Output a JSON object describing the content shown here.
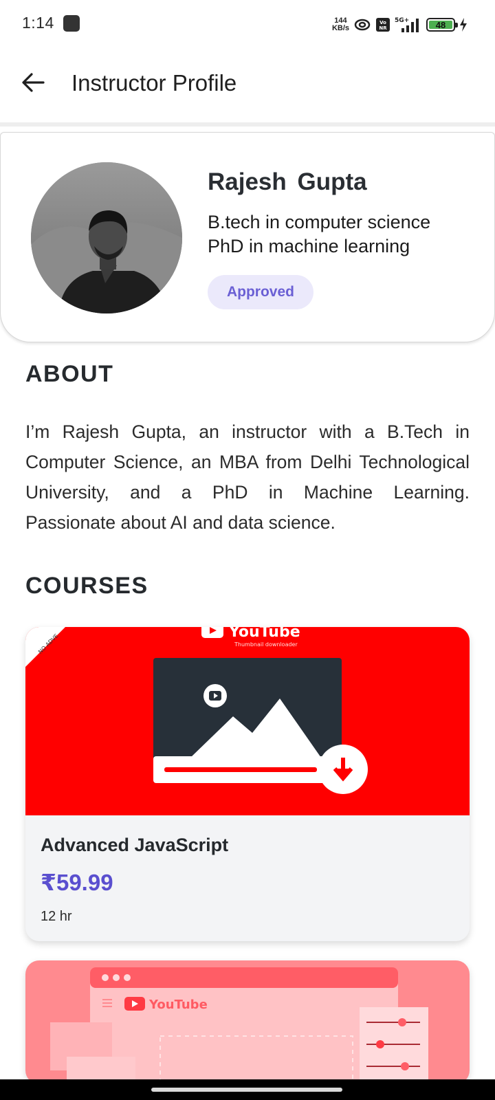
{
  "status_bar": {
    "time": "1:14",
    "net_speed_value": "144",
    "net_speed_unit": "KB/s",
    "volte_label": "Vo NR",
    "network_label": "5G+",
    "battery_level": "48"
  },
  "app_bar": {
    "title": "Instructor Profile",
    "back_icon": "arrow-left-icon"
  },
  "profile": {
    "name": "Rajesh  Gupta",
    "qualification_1": "B.tech in computer science",
    "qualification_2": "PhD in machine learning",
    "status": "Approved"
  },
  "about": {
    "heading": "ABOUT",
    "text": "I’m Rajesh Gupta, an instructor with a B.Tech in Computer Science, an MBA from Delhi Technological University, and a PhD in Machine Learning. Passionate about AI and data science."
  },
  "courses": {
    "heading": "COURSES",
    "items": [
      {
        "thumb_corner": "NO ADVE",
        "thumb_brand": "YouTube",
        "thumb_sub": "Thumbnail downloader",
        "title": "Advanced JavaScript",
        "price": "₹59.99",
        "duration": "12 hr"
      },
      {
        "thumb_brand": "YouTube"
      }
    ]
  },
  "colors": {
    "accent": "#5a4fcf",
    "badge_bg": "#ebe9fb",
    "thumb_red": "#ff0000",
    "thumb_pink": "#ff8a8f"
  }
}
